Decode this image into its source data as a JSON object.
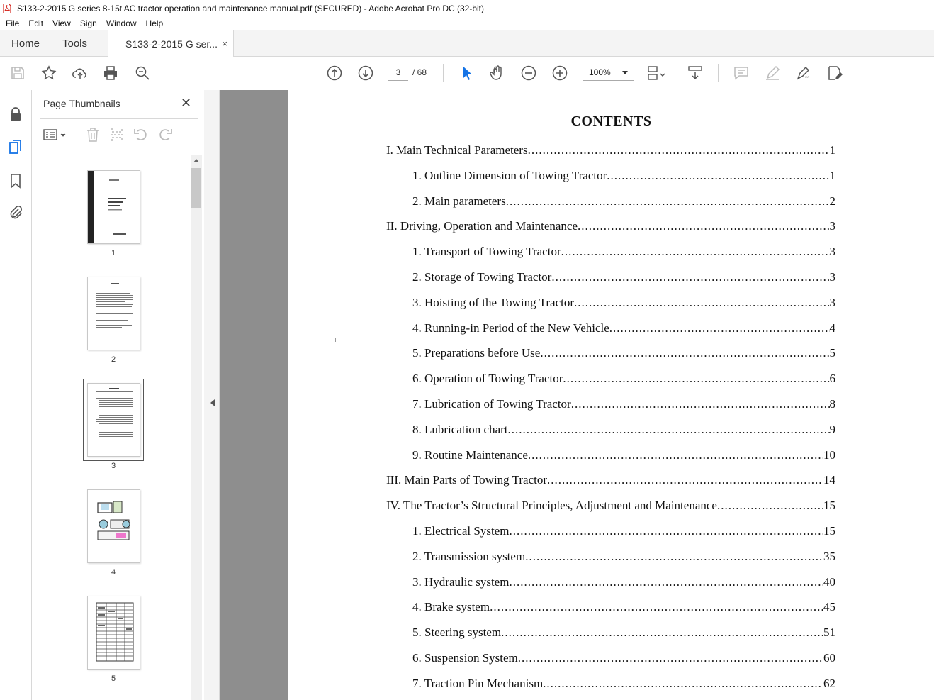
{
  "window": {
    "title": "S133-2-2015 G series 8-15t AC tractor operation and maintenance manual.pdf (SECURED) - Adobe Acrobat Pro DC (32-bit)"
  },
  "menu": [
    "File",
    "Edit",
    "View",
    "Sign",
    "Window",
    "Help"
  ],
  "tabs": {
    "home": "Home",
    "tools": "Tools",
    "document": "S133-2-2015 G ser...",
    "close_glyph": "×"
  },
  "toolbar": {
    "current_page": "3",
    "total_pages": "/ 68",
    "zoom": "100%"
  },
  "thumbnails_panel": {
    "title": "Page Thumbnails",
    "close_glyph": "✕",
    "pages": [
      {
        "label": "1"
      },
      {
        "label": "2"
      },
      {
        "label": "3",
        "selected": true
      },
      {
        "label": "4"
      },
      {
        "label": "5"
      }
    ]
  },
  "document": {
    "heading": "CONTENTS",
    "toc": [
      {
        "text": "I. Main Technical Parameters",
        "page": "1",
        "level": 1
      },
      {
        "text": "1.  Outline  Dimension  of  Towing  Tractor",
        "page": "1",
        "level": 2
      },
      {
        "text": "2.  Main  parameters",
        "page": "2",
        "level": 2
      },
      {
        "text": "II.  Driving,  Operation  and  Maintenance",
        "page": "3",
        "level": 1
      },
      {
        "text": "1.  Transport  of  Towing  Tractor",
        "page": "3",
        "level": 2
      },
      {
        "text": "2.  Storage  of  Towing  Tractor",
        "page": "3",
        "level": 2
      },
      {
        "text": "3. Hoisting of the Towing Tractor",
        "page": "3",
        "level": 2
      },
      {
        "text": "4. Running-in Period of the New Vehicle",
        "page": "4",
        "level": 2
      },
      {
        "text": "5. Preparations before Use",
        "page": "5",
        "level": 2
      },
      {
        "text": "6. Operation of Towing Tractor",
        "page": "6",
        "level": 2
      },
      {
        "text": "7.  Lubrication  of  Towing  Tractor",
        "page": "8",
        "level": 2
      },
      {
        "text": "8.  Lubrication  chart",
        "page": "9",
        "level": 2
      },
      {
        "text": "9.  Routine  Maintenance",
        "page": "10",
        "level": 2
      },
      {
        "text": "III. Main Parts of Towing Tractor",
        "page": "14",
        "level": 1
      },
      {
        "text": "IV. The Tractor’s Structural Principles, Adjustment and Maintenance",
        "page": "15",
        "level": 1
      },
      {
        "text": "1.  Electrical  System",
        "page": "15",
        "level": 2
      },
      {
        "text": "2. Transmission system",
        "page": "35",
        "level": 2
      },
      {
        "text": "3. Hydraulic system",
        "page": "40",
        "level": 2
      },
      {
        "text": "4. Brake system",
        "page": "45",
        "level": 2
      },
      {
        "text": "5. Steering system",
        "page": "51",
        "level": 2
      },
      {
        "text": "6.  Suspension  System",
        "page": "60",
        "level": 2
      },
      {
        "text": "7. Traction Pin Mechanism",
        "page": "62",
        "level": 2
      }
    ]
  },
  "colors": {
    "accent": "#1473e6",
    "acrobat_red": "#d4241c",
    "doc_background": "#8e8e8e"
  }
}
